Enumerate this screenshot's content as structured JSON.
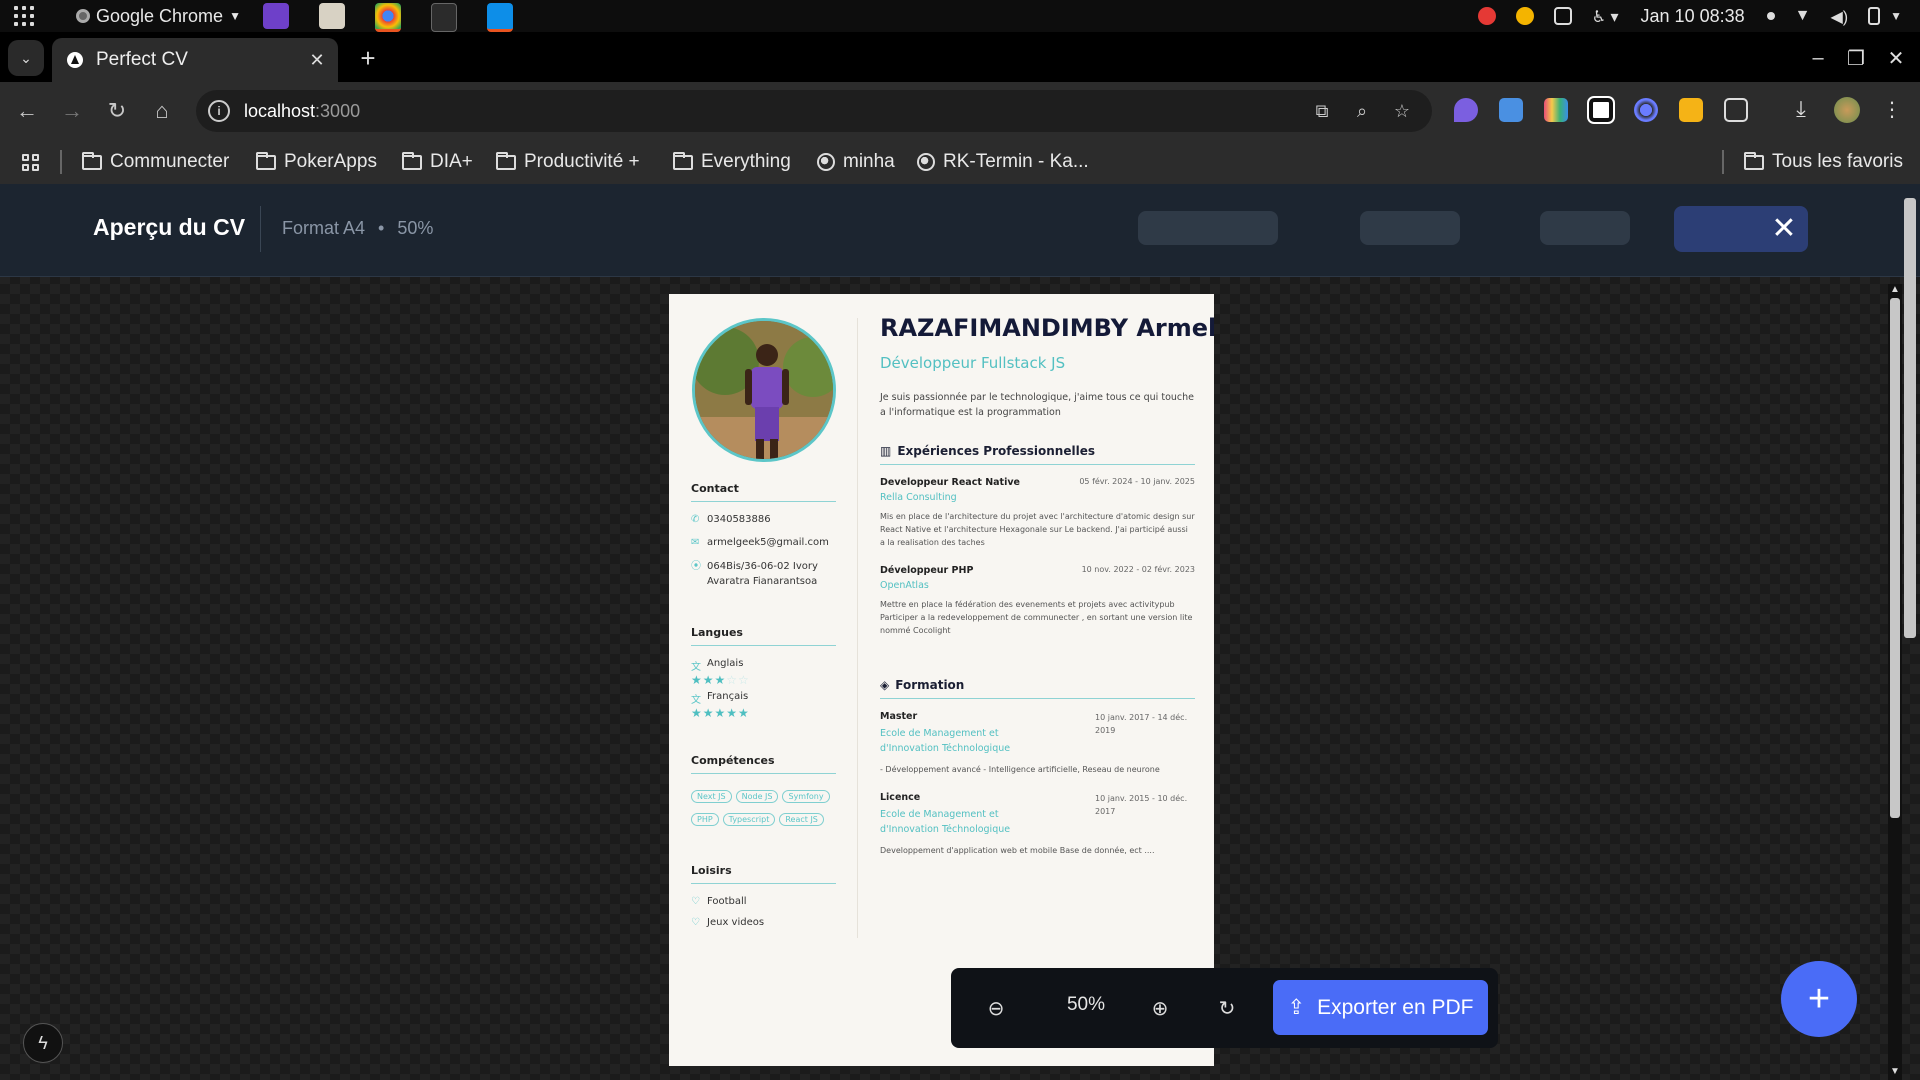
{
  "system": {
    "app_name": "Google Chrome",
    "clock": "Jan 10  08:38"
  },
  "browser": {
    "tab_title": "Perfect CV",
    "url_host": "localhost",
    "url_rest": ":3000",
    "bookmarks": [
      "Communecter",
      "PokerApps",
      "DIA+",
      "Productivité +",
      "Everything",
      "minha",
      "RK-Termin - Ka..."
    ],
    "all_bookmarks": "Tous les favoris"
  },
  "header": {
    "title": "Aperçu du CV",
    "format": "Format A4",
    "dot": "•",
    "zoom": "50%"
  },
  "cv": {
    "name": "RAZAFIMANDIMBY Armellin",
    "role": "Développeur Fullstack JS",
    "intro": "Je suis passionnée par le technologique, j'aime tous ce qui touche a l'informatique est la programmation",
    "contact": {
      "title": "Contact",
      "phone": "0340583886",
      "email": "armelgeek5@gmail.com",
      "address": "064Bis/36-06-02 Ivory Avaratra Fianarantsoa"
    },
    "languages": {
      "title": "Langues",
      "items": [
        {
          "name": "Anglais",
          "level": 3,
          "max": 5
        },
        {
          "name": "Français",
          "level": 5,
          "max": 5
        }
      ]
    },
    "skills": {
      "title": "Compétences",
      "items": [
        "Next JS",
        "Node JS",
        "Symfony",
        "PHP",
        "Typescript",
        "React JS"
      ]
    },
    "hobbies": {
      "title": "Loisirs",
      "items": [
        "Football",
        "Jeux videos"
      ]
    },
    "experience": {
      "title": "Expériences Professionnelles",
      "items": [
        {
          "title": "Developpeur React Native",
          "dates": "05 févr. 2024 - 10 janv. 2025",
          "company": "Rella Consulting",
          "desc": "Mis en place de l'architecture du projet avec l'architecture d'atomic design sur React Native et l'architecture Hexagonale sur Le backend. J'ai participé aussi a la realisation des taches"
        },
        {
          "title": "Développeur PHP",
          "dates": "10 nov. 2022 - 02 févr. 2023",
          "company": "OpenAtlas",
          "desc": "Mettre en place la fédération des evenements et projets avec activitypub Participer a la redeveloppement de communecter , en sortant une version lite nommé Cocolight"
        }
      ]
    },
    "education": {
      "title": "Formation",
      "items": [
        {
          "title": "Master",
          "dates": "10 janv. 2017 - 14 déc. 2019",
          "school": "Ecole de Management et d'Innovation Téchnologique",
          "desc": "- Développement avancé - Intelligence artificielle, Reseau de neurone"
        },
        {
          "title": "Licence",
          "dates": "10 janv. 2015 - 10 déc. 2017",
          "school": "Ecole de Management et d'Innovation Téchnologique",
          "desc": "Developpement d'application web et mobile Base de donnée, ect ...."
        }
      ]
    }
  },
  "controls": {
    "zoom": "50%",
    "export_label": "Exporter en PDF"
  },
  "colors": {
    "accent": "#4a6cf7",
    "teal": "#5cc6c8",
    "header_bg": "#1c2530"
  }
}
